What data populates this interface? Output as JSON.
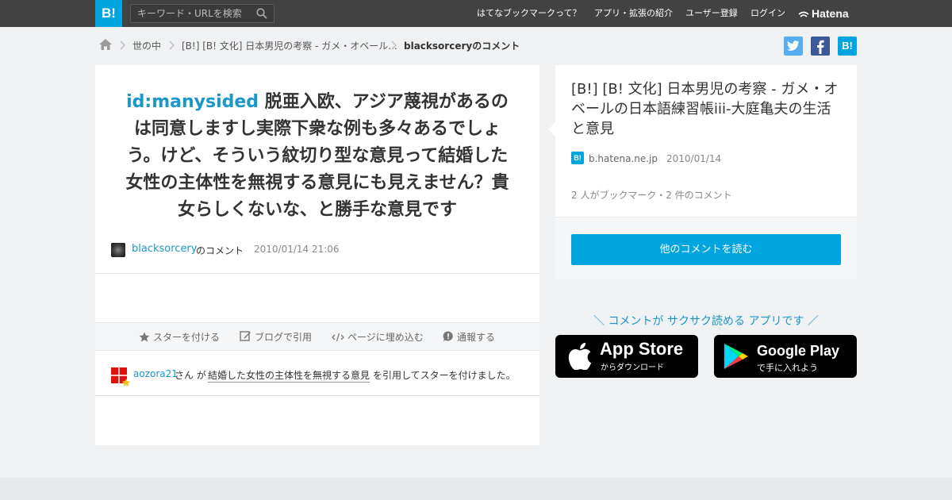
{
  "topbar": {
    "logo": "B!",
    "search_placeholder": "キーワード・URLを検索",
    "nav": [
      "はてなブックマークって？",
      "アプリ・拡張の紹介",
      "ユーザー登録",
      "ログイン"
    ],
    "brand": "Hatena"
  },
  "breadcrumb": {
    "items": [
      "世の中",
      "[B!] [B! 文化] 日本男児の考察 - ガメ・オベール...",
      "blacksorceryのコメント"
    ]
  },
  "share": {
    "hatena": "B!"
  },
  "comment": {
    "mention": "id:manysided",
    "body": "脱亜入欧、アジア蔑視があるのは同意しますし実際下衆な例も多々あるでしょう。けど、そういう紋切り型な意見って結婚した女性の主体性を無視する意見にも見えません？貴女らしくないな、と勝手な意見です",
    "user": "blacksorcery",
    "user_suffix": "のコメント",
    "datetime": "2010/01/14 21:06"
  },
  "actions": [
    "スターを付ける",
    "ブログで引用",
    "ページに埋め込む",
    "通報する"
  ],
  "star_activity": {
    "user": "aozora21",
    "text1": "さん が",
    "quote": "結婚した女性の主体性を無視する意見",
    "text2": "を引用してスターを付けました。"
  },
  "side": {
    "title": "[B!] [B! 文化] 日本男児の考察 - ガメ・オベールの日本語練習帳iii-大庭亀夫の生活と意見",
    "favicon": "B!",
    "site": "b.hatena.ne.jp",
    "date": "2010/01/14",
    "count": "2 人がブックマーク・2 件のコメント",
    "read_more": "他のコメントを読む"
  },
  "promo": {
    "text": "＼ コメントが サクサク読める アプリです ／",
    "appstore_big": "App Store",
    "appstore_small": "からダウンロード",
    "googleplay_big": "Google Play",
    "googleplay_small": "で手に入れよう"
  },
  "colors": {
    "topbar": "#424242",
    "accent": "#00a4de",
    "link": "#1a97c9",
    "twitter": "#55acee",
    "facebook": "#3b5998"
  }
}
